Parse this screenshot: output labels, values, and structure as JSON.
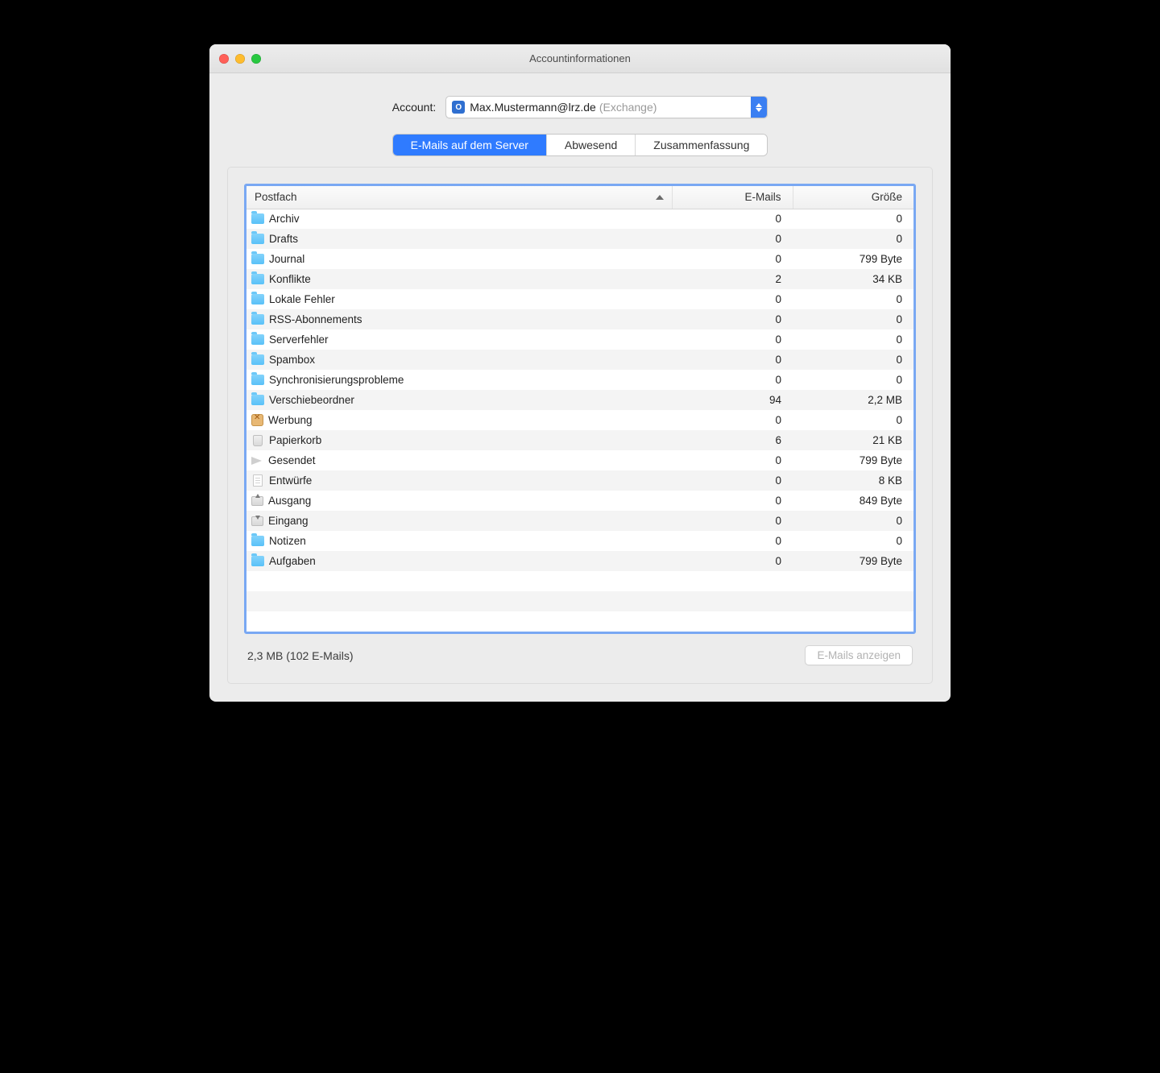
{
  "window": {
    "title": "Accountinformationen"
  },
  "account": {
    "label": "Account:",
    "iconLetter": "O",
    "email": "Max.Mustermann@lrz.de",
    "type": "(Exchange)"
  },
  "tabs": [
    {
      "label": "E-Mails auf dem Server",
      "active": true
    },
    {
      "label": "Abwesend",
      "active": false
    },
    {
      "label": "Zusammenfassung",
      "active": false
    }
  ],
  "table": {
    "headers": {
      "mailbox": "Postfach",
      "emails": "E-Mails",
      "size": "Größe"
    },
    "rows": [
      {
        "icon": "folder",
        "name": "Archiv",
        "emails": "0",
        "size": "0"
      },
      {
        "icon": "folder",
        "name": "Drafts",
        "emails": "0",
        "size": "0"
      },
      {
        "icon": "folder",
        "name": "Journal",
        "emails": "0",
        "size": "799 Byte"
      },
      {
        "icon": "folder",
        "name": "Konflikte",
        "emails": "2",
        "size": "34 KB"
      },
      {
        "icon": "folder",
        "name": "Lokale Fehler",
        "emails": "0",
        "size": "0"
      },
      {
        "icon": "folder",
        "name": "RSS-Abonnements",
        "emails": "0",
        "size": "0"
      },
      {
        "icon": "folder",
        "name": "Serverfehler",
        "emails": "0",
        "size": "0"
      },
      {
        "icon": "folder",
        "name": "Spambox",
        "emails": "0",
        "size": "0"
      },
      {
        "icon": "folder",
        "name": "Synchronisierungsprobleme",
        "emails": "0",
        "size": "0"
      },
      {
        "icon": "folder",
        "name": "Verschiebeordner",
        "emails": "94",
        "size": "2,2 MB"
      },
      {
        "icon": "junk",
        "name": "Werbung",
        "emails": "0",
        "size": "0"
      },
      {
        "icon": "trash",
        "name": "Papierkorb",
        "emails": "6",
        "size": "21 KB"
      },
      {
        "icon": "sent",
        "name": "Gesendet",
        "emails": "0",
        "size": "799 Byte"
      },
      {
        "icon": "doc",
        "name": "Entwürfe",
        "emails": "0",
        "size": "8 KB"
      },
      {
        "icon": "tray-out",
        "name": "Ausgang",
        "emails": "0",
        "size": "849 Byte"
      },
      {
        "icon": "tray-in",
        "name": "Eingang",
        "emails": "0",
        "size": "0"
      },
      {
        "icon": "folder",
        "name": "Notizen",
        "emails": "0",
        "size": "0"
      },
      {
        "icon": "folder",
        "name": "Aufgaben",
        "emails": "0",
        "size": "799 Byte"
      }
    ],
    "extraBlankRows": 3
  },
  "footer": {
    "summary": "2,3 MB (102 E-Mails)",
    "buttonLabel": "E-Mails anzeigen"
  }
}
